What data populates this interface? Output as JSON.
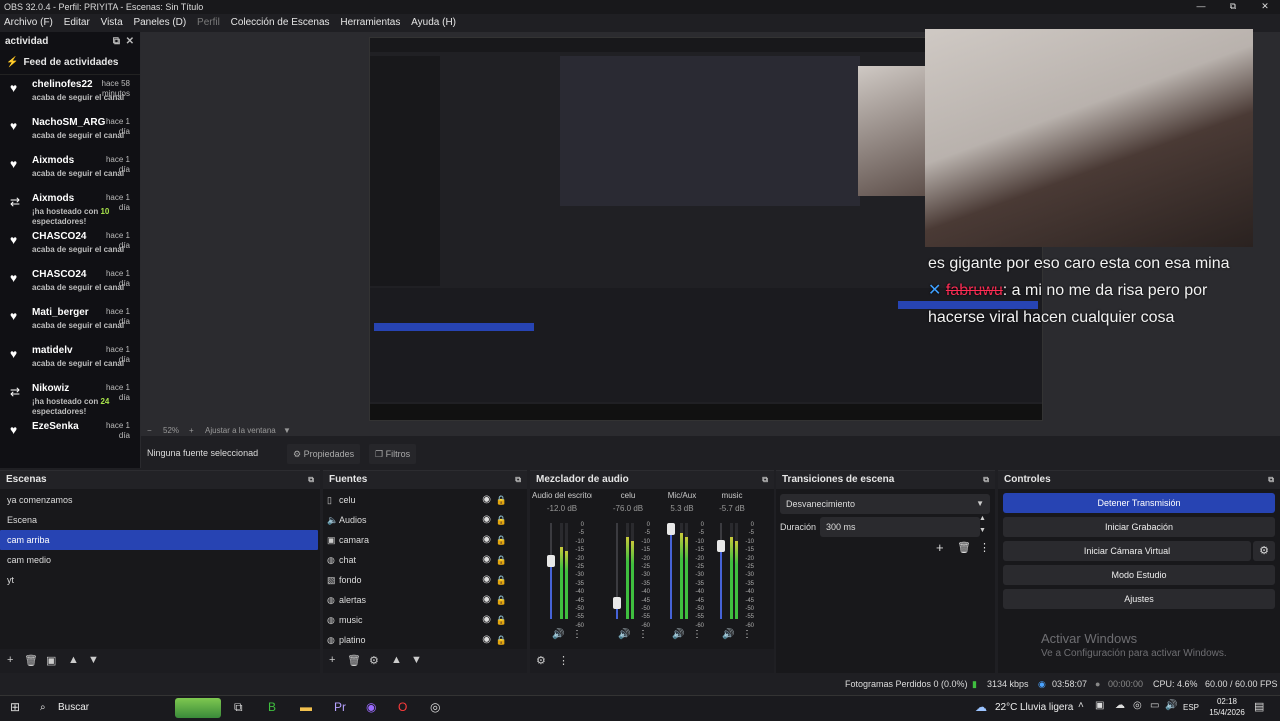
{
  "window": {
    "title": "OBS 32.0.4 - Perfil: PRIYITA - Escenas: Sin Título",
    "min": "—",
    "max": "⧉",
    "close": "✕"
  },
  "menu": [
    "Archivo (F)",
    "Editar",
    "Vista",
    "Paneles (D)",
    "Perfil",
    "Colección de Escenas",
    "Herramientas",
    "Ayuda (H)"
  ],
  "activity": {
    "title": "actividad",
    "feed_title": "Feed de actividades",
    "items": [
      {
        "name": "chelinofes22",
        "time": "hace 58 minutos",
        "action": "acaba de seguir el canal",
        "icon": "heart-icon"
      },
      {
        "name": "NachoSM_ARG",
        "time": "hace 1 día",
        "action": "acaba de seguir el canal",
        "icon": "heart-icon"
      },
      {
        "name": "Aixmods",
        "time": "hace 1 día",
        "action": "acaba de seguir el canal",
        "icon": "heart-icon"
      },
      {
        "name": "Aixmods",
        "time": "hace 1 día",
        "action": "¡ha hosteado con",
        "count": "10",
        "action2": "espectadores!",
        "icon": "host-icon"
      },
      {
        "name": "CHASCO24",
        "time": "hace 1 día",
        "action": "acaba de seguir el canal",
        "icon": "heart-icon"
      },
      {
        "name": "CHASCO24",
        "time": "hace 1 día",
        "action": "acaba de seguir el canal",
        "icon": "heart-icon"
      },
      {
        "name": "Mati_berger",
        "time": "hace 1 día",
        "action": "acaba de seguir el canal",
        "icon": "heart-icon"
      },
      {
        "name": "matidelv",
        "time": "hace 1 día",
        "action": "acaba de seguir el canal",
        "icon": "heart-icon"
      },
      {
        "name": "Nikowiz",
        "time": "hace 1 día",
        "action": "¡ha hosteado con",
        "count": "24",
        "action2": "espectadores!",
        "icon": "host-icon"
      },
      {
        "name": "EzeSenka",
        "time": "hace 1 día",
        "action": "",
        "icon": "heart-icon"
      }
    ]
  },
  "preview": {
    "chat1": "es gigante por eso caro esta con esa mina",
    "chat2_name": "fabruwu",
    "chat2_text": ": a mi no me da risa pero por hacerse viral hacen cualquier cosa",
    "zoom": "52%",
    "zoom_label": "Ajustar a la ventana"
  },
  "sourcebar": {
    "no_source": "Ninguna fuente seleccionad",
    "props": "Propiedades",
    "filters": "Filtros"
  },
  "scenes": {
    "title": "Escenas",
    "items": [
      "ya comenzamos",
      "Escena",
      "cam arriba",
      "cam  medio",
      "yt"
    ],
    "active_index": 2
  },
  "sources": {
    "title": "Fuentes",
    "items": [
      {
        "name": "celu",
        "icon": "phone-icon"
      },
      {
        "name": "Audios",
        "icon": "speaker-icon"
      },
      {
        "name": "camara",
        "icon": "camera-icon"
      },
      {
        "name": "chat",
        "icon": "browser-icon"
      },
      {
        "name": "fondo",
        "icon": "image-icon"
      },
      {
        "name": "alertas",
        "icon": "browser-icon"
      },
      {
        "name": "music",
        "icon": "browser-icon"
      },
      {
        "name": "platino",
        "icon": "browser-icon"
      }
    ]
  },
  "mixer": {
    "title": "Mezclador de audio",
    "scale": [
      "0",
      "-5",
      "-10",
      "-15",
      "-20",
      "-25",
      "-30",
      "-35",
      "-40",
      "-45",
      "-50",
      "-55",
      "-60"
    ],
    "channels": [
      {
        "name": "Audio del escritorio",
        "db": "-12.0 dB",
        "fader": 0.62,
        "level": 0.75
      },
      {
        "name": "celu",
        "db": "-76.0 dB",
        "fader": 0.12,
        "level": 0.85
      },
      {
        "name": "Mic/Aux",
        "db": "5.3 dB",
        "fader": 1.0,
        "level": 0.9
      },
      {
        "name": "music",
        "db": "-5.7 dB",
        "fader": 0.8,
        "level": 0.85
      }
    ]
  },
  "transitions": {
    "title": "Transiciones de escena",
    "selected": "Desvanecimiento",
    "duration_label": "Duración",
    "duration": "300 ms"
  },
  "controls": {
    "title": "Controles",
    "buttons": [
      "Detener Transmisión",
      "Iniciar Grabación",
      "Iniciar Cámara Virtual",
      "Modo Estudio",
      "Ajustes"
    ]
  },
  "watermark": {
    "line1": "Activar Windows",
    "line2": "Ve a Configuración para activar Windows."
  },
  "status": {
    "dropped": "Fotogramas Perdidos 0 (0.0%)",
    "bitrate": "3134 kbps",
    "live_time": "03:58:07",
    "rec_time": "00:00:00",
    "cpu": "CPU: 4.6%",
    "fps": "60.00 / 60.00 FPS"
  },
  "taskbar": {
    "search": "Buscar",
    "weather_temp": "22°C",
    "weather_desc": "Lluvia ligera",
    "lang": "ESP",
    "time": "02:18",
    "date": "15/4/2026"
  },
  "colors": {
    "accent": "#2744b3",
    "meter_green": "#3fbf3f",
    "meter_yellow": "#c9c93a",
    "chat_name": "#ff2d55"
  }
}
